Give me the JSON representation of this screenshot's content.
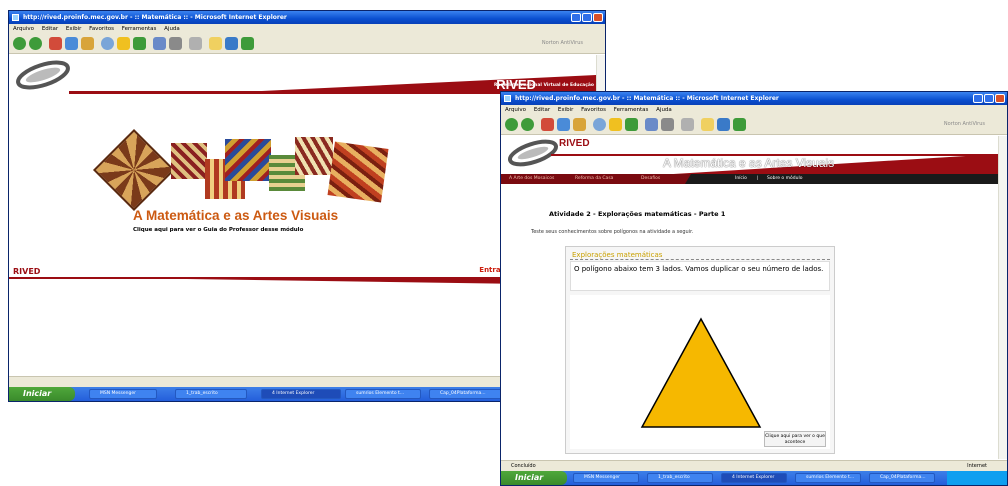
{
  "window1": {
    "title": "http://rived.proinfo.mec.gov.br - :: Matemática :: - Microsoft Internet Explorer",
    "menu": [
      "Arquivo",
      "Editar",
      "Exibir",
      "Favoritos",
      "Ferramentas",
      "Ajuda"
    ],
    "toolbar_link": "Norton AntiVirus",
    "banner_logo": "RIVED",
    "banner_tagline": "Rede Internacional Virtual de Educação",
    "module_title": "A Matemática e as Artes Visuais",
    "guide_link": "Clique aqui para ver o Guia do Professor desse módulo",
    "footer_logo": "RIVED",
    "enter_link": "Entrar no módulo",
    "taskbar": {
      "start": "Iniciar",
      "items": [
        "MSN Messenger",
        "1_trab_escrito",
        "4 Internet Explorer",
        "sumrios Elemento t...",
        "Cap_04Plataforma..."
      ]
    }
  },
  "window2": {
    "title": "http://rived.proinfo.mec.gov.br - :: Matemática :: - Microsoft Internet Explorer",
    "menu": [
      "Arquivo",
      "Editar",
      "Exibir",
      "Favoritos",
      "Ferramentas",
      "Ajuda"
    ],
    "toolbar_link": "Norton AntiVirus",
    "banner_logo": "RIVED",
    "banner_title": "A Matemática e as Artes Visuais",
    "nav_tabs": [
      "A Arte dos Mosaicos",
      "Reforma da Casa",
      "Desafios"
    ],
    "nav_right": [
      "Início",
      "Sobre o módulo"
    ],
    "activity_title": "Atividade 2 - Explorações matemáticas - Parte 1",
    "instruction": "Teste seus conhecimentos sobre polígonos na atividade a seguir.",
    "panel_title": "Explorações matemáticas",
    "panel_text": "O polígono abaixo tem 3 lados. Vamos duplicar o seu número de lados.",
    "click_button": "Clique aqui para ver o que acontece",
    "status": "Concluído",
    "zone": "Internet",
    "taskbar": {
      "start": "Iniciar",
      "items": [
        "MSN Messenger",
        "1_trab_escrito",
        "4 Internet Explorer",
        "sumrios Elemento t...",
        "Cap_04Plataforma..."
      ]
    }
  },
  "colors": {
    "banner_red": "#9b0d13",
    "title_orange": "#cc5a12",
    "triangle": "#f6b800",
    "xp_blue": "#245edb"
  }
}
